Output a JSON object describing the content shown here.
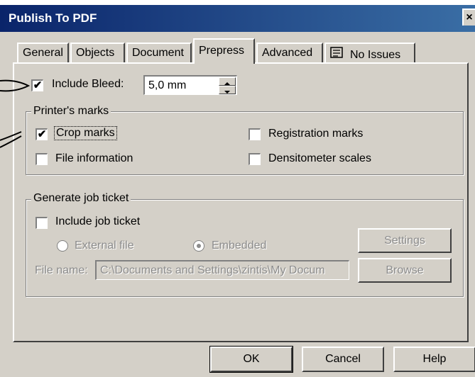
{
  "window": {
    "title": "Publish To PDF",
    "close_glyph": "×"
  },
  "tabs": [
    {
      "label": "General"
    },
    {
      "label": "Objects"
    },
    {
      "label": "Document"
    },
    {
      "label": "Prepress",
      "active": true
    },
    {
      "label": "Advanced"
    },
    {
      "label": "No Issues",
      "icon": "checklist-icon"
    }
  ],
  "bleed": {
    "label": "Include Bleed:",
    "checked": true,
    "value": "5,0 mm"
  },
  "printers_marks": {
    "title": "Printer's marks",
    "crop_marks": {
      "label": "Crop marks",
      "checked": true
    },
    "registration_marks": {
      "label": "Registration marks",
      "checked": false
    },
    "file_information": {
      "label": "File information",
      "checked": false
    },
    "densitometer_scales": {
      "label": "Densitometer scales",
      "checked": false
    }
  },
  "job_ticket": {
    "title": "Generate job ticket",
    "include": {
      "label": "Include job ticket",
      "checked": false
    },
    "external_file": {
      "label": "External file",
      "selected": false
    },
    "embedded": {
      "label": "Embedded",
      "selected": true
    },
    "settings_label": "Settings",
    "file_name_label": "File name:",
    "file_name_value": "C:\\Documents and Settings\\zintis\\My Docum",
    "browse_label": "Browse"
  },
  "buttons": {
    "ok": "OK",
    "cancel": "Cancel",
    "help": "Help"
  },
  "check_glyph": "✔"
}
